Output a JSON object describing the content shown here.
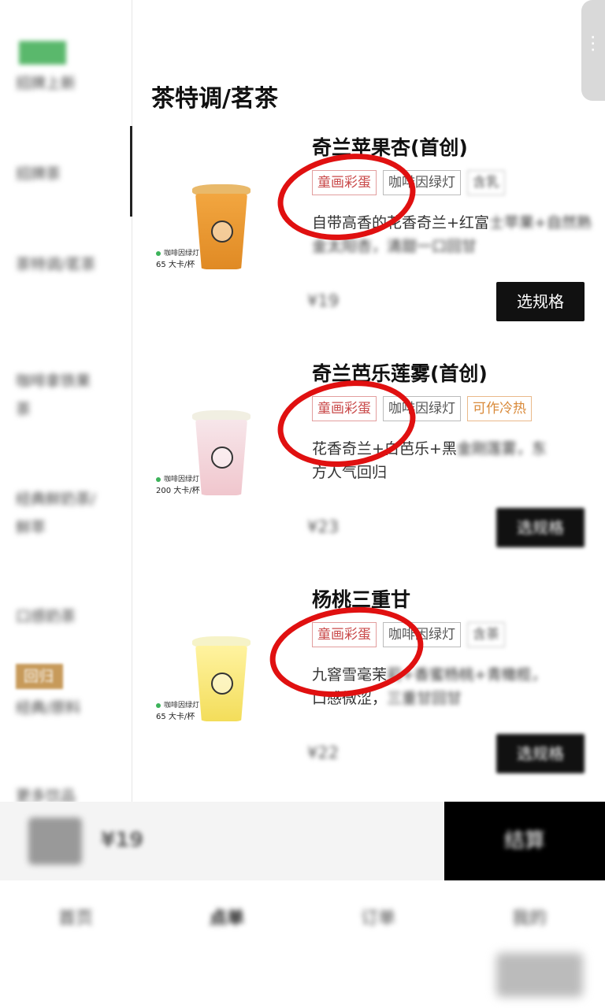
{
  "sidebar": {
    "items": [
      {
        "label": "招牌上新"
      },
      {
        "label": "招牌茶"
      },
      {
        "label": "茶特调/茗茶"
      },
      {
        "label": "咖啡拿铁果茶"
      },
      {
        "label": "经典鲜奶茶/鲜萃"
      },
      {
        "label": "口感奶茶"
      },
      {
        "label": "经典/原料"
      },
      {
        "label": "更多饮品"
      }
    ],
    "badge_label": "回归"
  },
  "section": {
    "title": "茶特调/茗茶"
  },
  "products": [
    {
      "name": "奇兰苹果杏(首创)",
      "tags": [
        "童画彩蛋",
        "咖啡因绿灯",
        "含乳"
      ],
      "desc_visible": "自带高香的花香奇兰+红富",
      "desc_blurred": "士苹果+自然熟金太阳杏，清甜一口回甘",
      "calorie_label": "咖啡因绿灯",
      "calorie_value": "65",
      "calorie_unit": "大卡/杯",
      "price": "¥19",
      "button": "选规格"
    },
    {
      "name": "奇兰芭乐莲雾(首创)",
      "tags": [
        "童画彩蛋",
        "咖啡因绿灯",
        "可作冷热"
      ],
      "desc_visible": "花香奇兰+白芭乐+黑",
      "desc_blurred": "金刚莲雾，东",
      "desc_visible2": "方人气回归",
      "calorie_label": "咖啡因绿灯",
      "calorie_value": "200",
      "calorie_unit": "大卡/杯",
      "price": "¥23",
      "button": "选规格"
    },
    {
      "name": "杨桃三重甘",
      "tags": [
        "童画彩蛋",
        "咖啡因绿灯",
        "含茶"
      ],
      "desc_visible": "九窨雪毫茉",
      "desc_blurred": "莉+香蜜杨桃+青橄榄，",
      "desc_visible2": "口感微涩，",
      "desc_blurred2": "三重甘回甘",
      "calorie_label": "咖啡因绿灯",
      "calorie_value": "65",
      "calorie_unit": "大卡/杯",
      "price": "¥22",
      "button": "选规格"
    }
  ],
  "cart": {
    "amount": "¥19",
    "checkout_label": "结算"
  },
  "bottom_nav": {
    "items": [
      "首页",
      "点单",
      "订单",
      "我的"
    ]
  },
  "colors": {
    "accent": "#111111",
    "tag_red": "#c94a4a",
    "annotation": "#e01010",
    "calorie_dot": "#3cb35a"
  }
}
